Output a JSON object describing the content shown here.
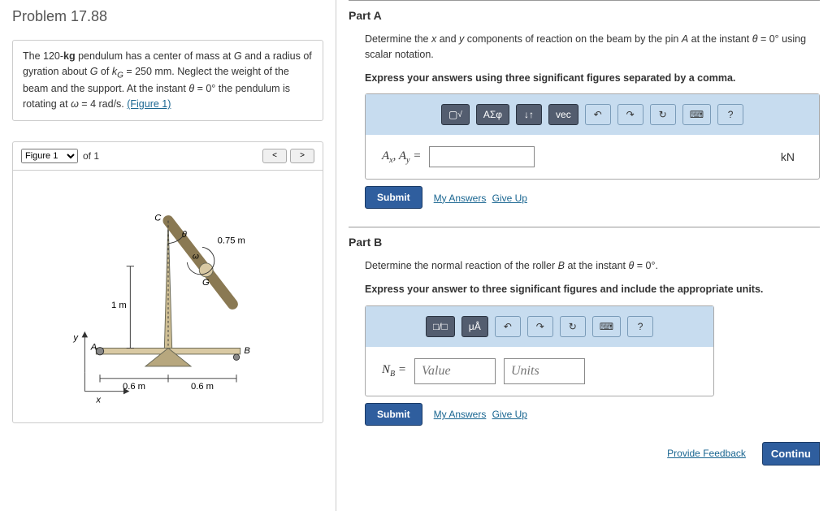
{
  "problem": {
    "title": "Problem 17.88",
    "description_html": "The 120-kg pendulum has a center of mass at G and a radius of gyration about G of k_G = 250 mm. Neglect the weight of the beam and the support. At the instant θ = 0° the pendulum is rotating at ω = 4 rad/s.",
    "figure_link": "(Figure 1)"
  },
  "figure": {
    "selector": "Figure 1",
    "of_label": "of 1",
    "dims": {
      "len_pendulum": "0.75 m",
      "height": "1 m",
      "left": "0.6 m",
      "right": "0.6 m"
    },
    "labels": {
      "A": "A",
      "B": "B",
      "C": "C",
      "G": "G",
      "theta": "θ",
      "omega": "ω",
      "x": "x",
      "y": "y"
    }
  },
  "partA": {
    "label": "Part A",
    "prompt": "Determine the x and y components of reaction on the beam by the pin A at the instant θ = 0° using scalar notation.",
    "instruction": "Express your answers using three significant figures separated by a comma.",
    "var_label": "Aₓ, A_y =",
    "unit": "kN",
    "toolbar": [
      "√",
      "ΑΣφ",
      "↓↑",
      "vec",
      "↶",
      "↷",
      "↻",
      "⌨",
      "?"
    ]
  },
  "partB": {
    "label": "Part B",
    "prompt": "Determine the normal reaction of the roller B at the instant θ = 0°.",
    "instruction": "Express your answer to three significant figures and include the appropriate units.",
    "var_label": "N_B =",
    "value_ph": "Value",
    "units_ph": "Units",
    "toolbar": [
      "□/□",
      "μÅ",
      "↶",
      "↷",
      "↻",
      "⌨",
      "?"
    ]
  },
  "buttons": {
    "submit": "Submit",
    "my_answers": "My Answers",
    "give_up": "Give Up",
    "feedback": "Provide Feedback",
    "continue": "Continu"
  }
}
